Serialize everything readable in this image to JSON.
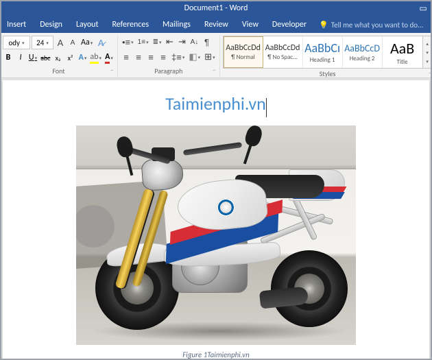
{
  "titlebar": {
    "title": "Document1 - Word"
  },
  "tabs": {
    "insert": "Insert",
    "design": "Design",
    "layout": "Layout",
    "references": "References",
    "mailings": "Mailings",
    "review": "Review",
    "view": "View",
    "developer": "Developer",
    "tellme": "Tell me what you want to do..."
  },
  "font": {
    "family": "ody",
    "size": "24",
    "grow": "A",
    "shrink": "A",
    "changecase": "Aa",
    "bold": "B",
    "italic": "I",
    "underline": "U",
    "strike": "abc",
    "sub": "x₂",
    "sup": "x²",
    "group_label": "Font"
  },
  "paragraph": {
    "group_label": "Paragraph"
  },
  "styles": {
    "group_label": "Styles",
    "items": [
      {
        "preview": "AaBbCcDd",
        "name": "¶ Normal",
        "cls": ""
      },
      {
        "preview": "AaBbCcDd",
        "name": "¶ No Spac...",
        "cls": ""
      },
      {
        "preview": "AaBbCı",
        "name": "Heading 1",
        "cls": "big"
      },
      {
        "preview": "AaBbCcD",
        "name": "Heading 2",
        "cls": "big"
      },
      {
        "preview": "AaB",
        "name": "Title",
        "cls": "huge"
      }
    ]
  },
  "document": {
    "heading": "Taimienphi.vn",
    "caption": "Figure 1Taimienphi.vn"
  }
}
